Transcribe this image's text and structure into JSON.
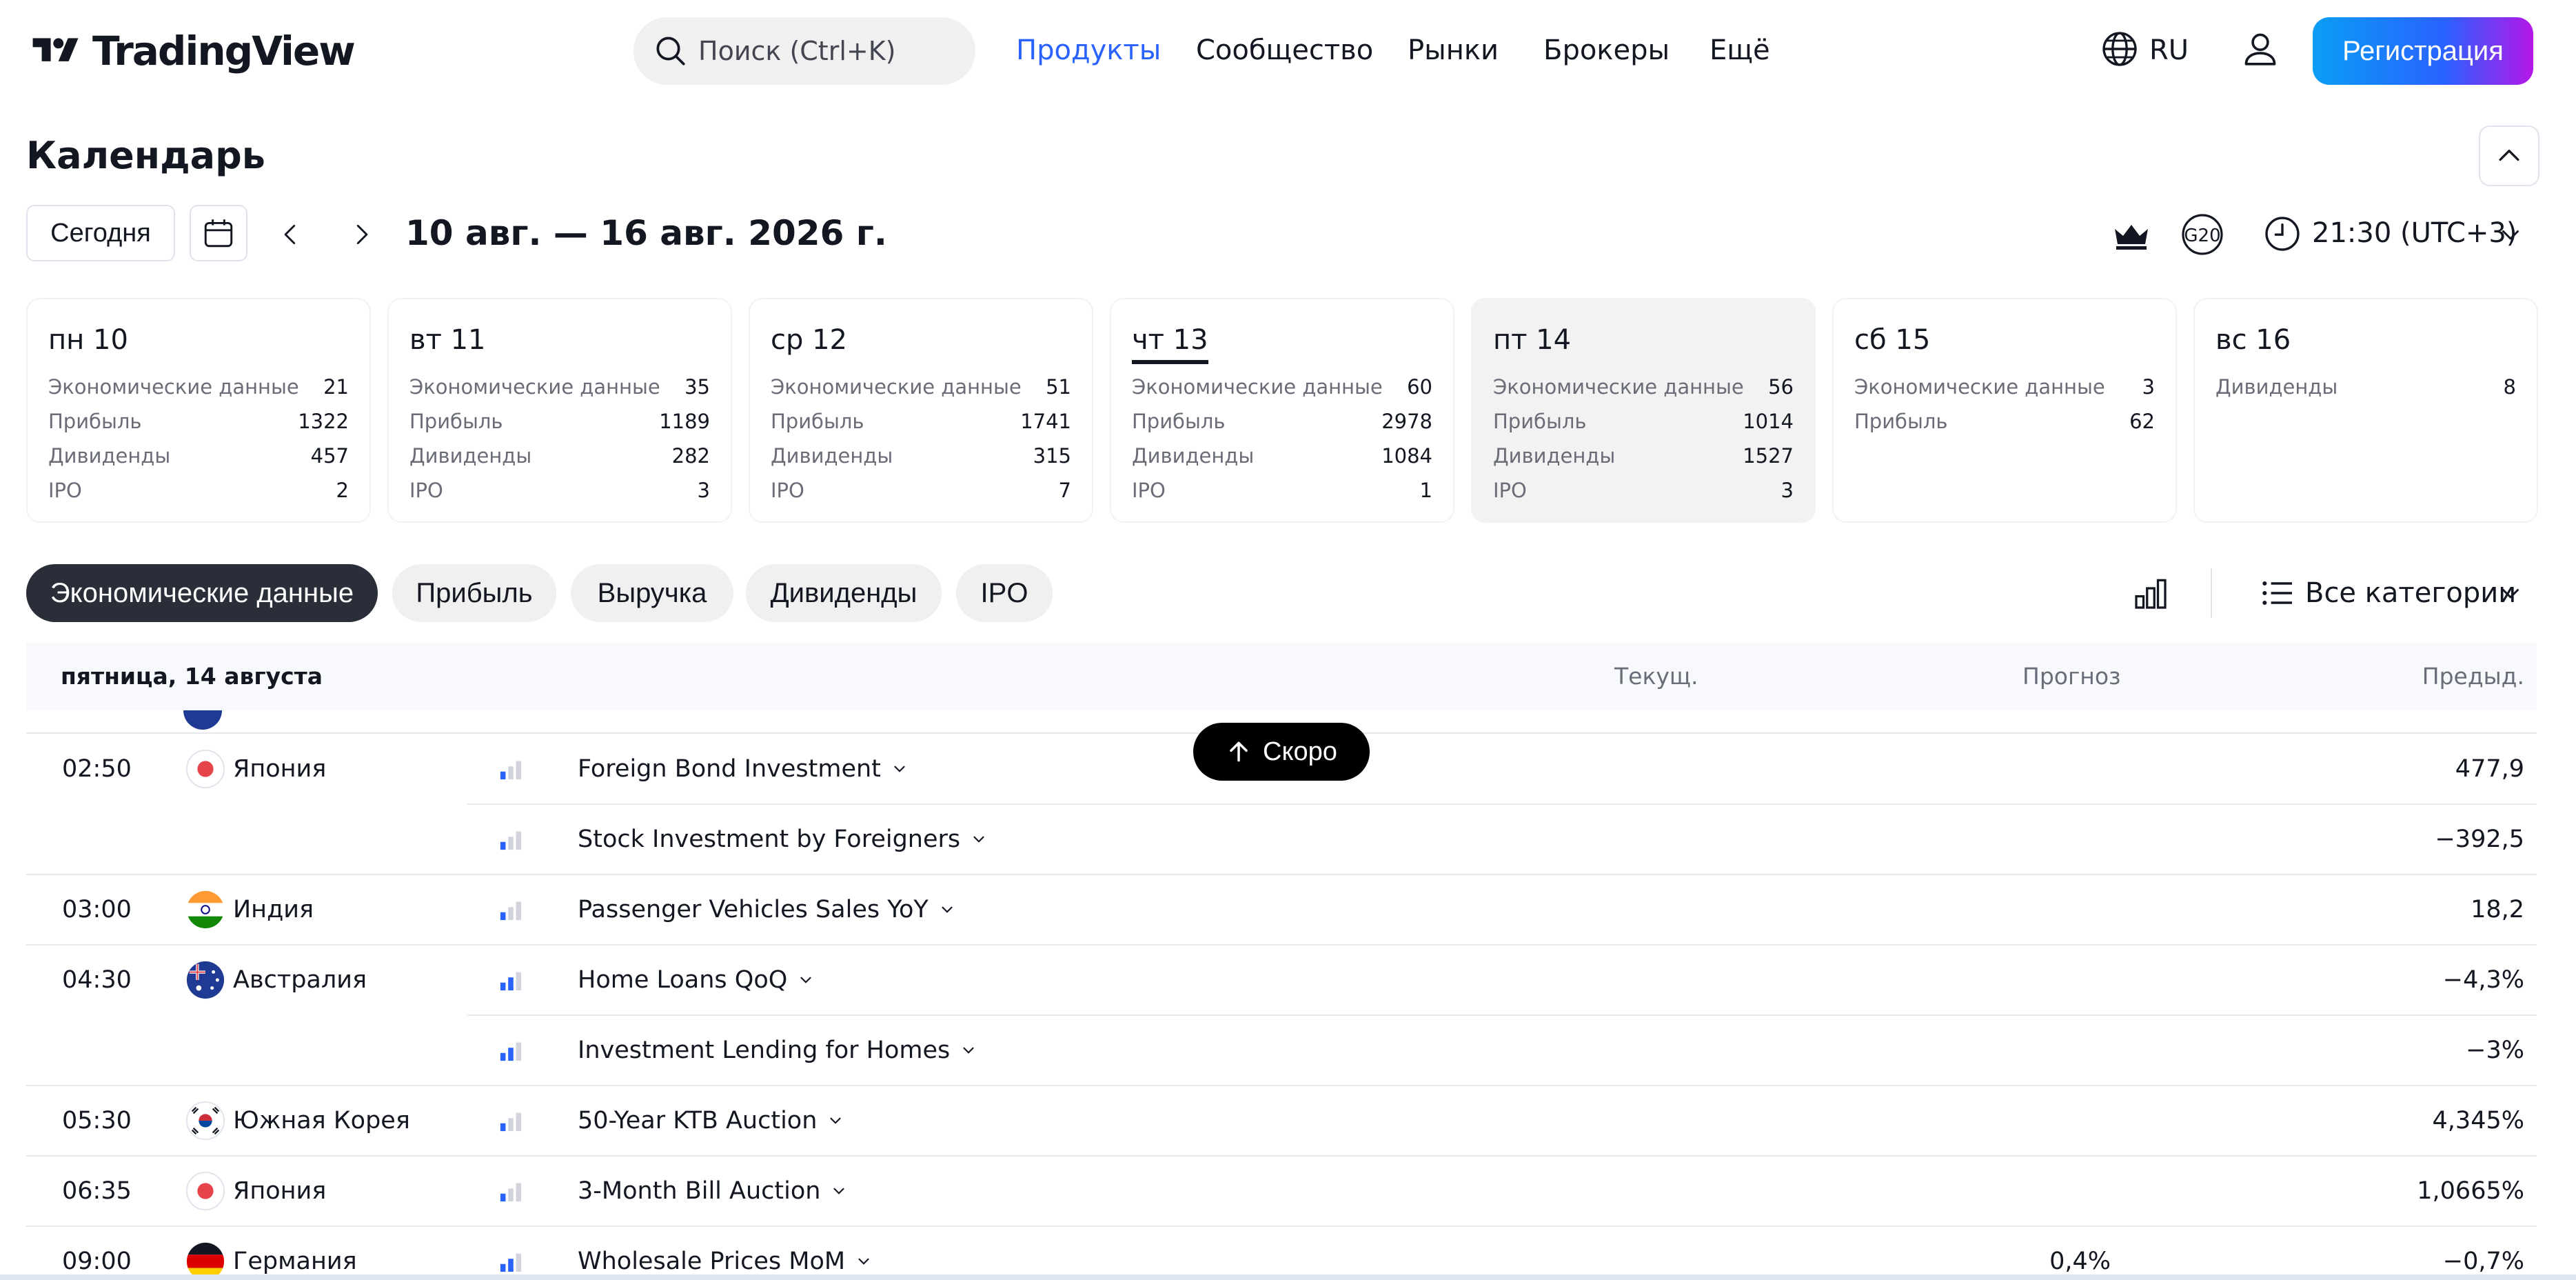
{
  "header": {
    "logo_text": "TradingView",
    "search_placeholder": "Поиск (Ctrl+K)",
    "nav": [
      "Продукты",
      "Сообщество",
      "Рынки",
      "Брокеры",
      "Ещё"
    ],
    "active_nav": "Продукты",
    "lang": "RU",
    "register_label": "Регистрация",
    "accent_color": "#2962ff"
  },
  "page_title": "Календарь",
  "toolbar": {
    "today_label": "Сегодня",
    "date_range": "10 авг. — 16 авг. 2026 г.",
    "g20_label": "G20",
    "timezone": "21:30 (UTC+3)"
  },
  "days": [
    {
      "label": "пн 10",
      "stats": [
        {
          "name": "Экономические данные",
          "value": "21"
        },
        {
          "name": "Прибыль",
          "value": "1322"
        },
        {
          "name": "Дивиденды",
          "value": "457"
        },
        {
          "name": "IPO",
          "value": "2"
        }
      ]
    },
    {
      "label": "вт 11",
      "stats": [
        {
          "name": "Экономические данные",
          "value": "35"
        },
        {
          "name": "Прибыль",
          "value": "1189"
        },
        {
          "name": "Дивиденды",
          "value": "282"
        },
        {
          "name": "IPO",
          "value": "3"
        }
      ]
    },
    {
      "label": "ср 12",
      "stats": [
        {
          "name": "Экономические данные",
          "value": "51"
        },
        {
          "name": "Прибыль",
          "value": "1741"
        },
        {
          "name": "Дивиденды",
          "value": "315"
        },
        {
          "name": "IPO",
          "value": "7"
        }
      ]
    },
    {
      "label": "чт 13",
      "stats": [
        {
          "name": "Экономические данные",
          "value": "60"
        },
        {
          "name": "Прибыль",
          "value": "2978"
        },
        {
          "name": "Дивиденды",
          "value": "1084"
        },
        {
          "name": "IPO",
          "value": "1"
        }
      ]
    },
    {
      "label": "пт 14",
      "stats": [
        {
          "name": "Экономические данные",
          "value": "56"
        },
        {
          "name": "Прибыль",
          "value": "1014"
        },
        {
          "name": "Дивиденды",
          "value": "1527"
        },
        {
          "name": "IPO",
          "value": "3"
        }
      ]
    },
    {
      "label": "сб 15",
      "stats": [
        {
          "name": "Экономические данные",
          "value": "3"
        },
        {
          "name": "Прибыль",
          "value": "62"
        }
      ]
    },
    {
      "label": "вс 16",
      "stats": [
        {
          "name": "Дивиденды",
          "value": "8"
        }
      ]
    }
  ],
  "filters": [
    "Экономические данные",
    "Прибыль",
    "Выручка",
    "Дивиденды",
    "IPO"
  ],
  "active_filter": "Экономические данные",
  "categories_label": "Все категории",
  "table": {
    "day_header": "пятница, 14 августа",
    "col_actual": "Текущ.",
    "col_forecast": "Прогноз",
    "col_previous": "Предыд.",
    "rows": [
      {
        "time": "02:50",
        "country": "Япония",
        "flag": "japan-flag",
        "importance": "low",
        "event": "Foreign Bond Investment",
        "forecast": "",
        "previous": "477,9"
      },
      {
        "time": "",
        "country": "",
        "flag": "",
        "importance": "low",
        "event": "Stock Investment by Foreigners",
        "forecast": "",
        "previous": "−392,5"
      },
      {
        "time": "03:00",
        "country": "Индия",
        "flag": "india-flag",
        "importance": "low",
        "event": "Passenger Vehicles Sales YoY",
        "forecast": "",
        "previous": "18,2"
      },
      {
        "time": "04:30",
        "country": "Австралия",
        "flag": "australia-flag",
        "importance": "medium",
        "event": "Home Loans QoQ",
        "forecast": "",
        "previous": "−4,3%"
      },
      {
        "time": "",
        "country": "",
        "flag": "",
        "importance": "medium",
        "event": "Investment Lending for Homes",
        "forecast": "",
        "previous": "−3%"
      },
      {
        "time": "05:30",
        "country": "Южная Корея",
        "flag": "south-korea-flag",
        "importance": "low",
        "event": "50-Year KTB Auction",
        "forecast": "",
        "previous": "4,345%"
      },
      {
        "time": "06:35",
        "country": "Япония",
        "flag": "japan-flag",
        "importance": "low",
        "event": "3-Month Bill Auction",
        "forecast": "",
        "previous": "1,0665%"
      },
      {
        "time": "09:00",
        "country": "Германия",
        "flag": "germany-flag",
        "importance": "medium",
        "event": "Wholesale Prices MoM",
        "forecast": "0,4%",
        "previous": "−0,7%"
      }
    ]
  },
  "soon_label": "Скоро"
}
